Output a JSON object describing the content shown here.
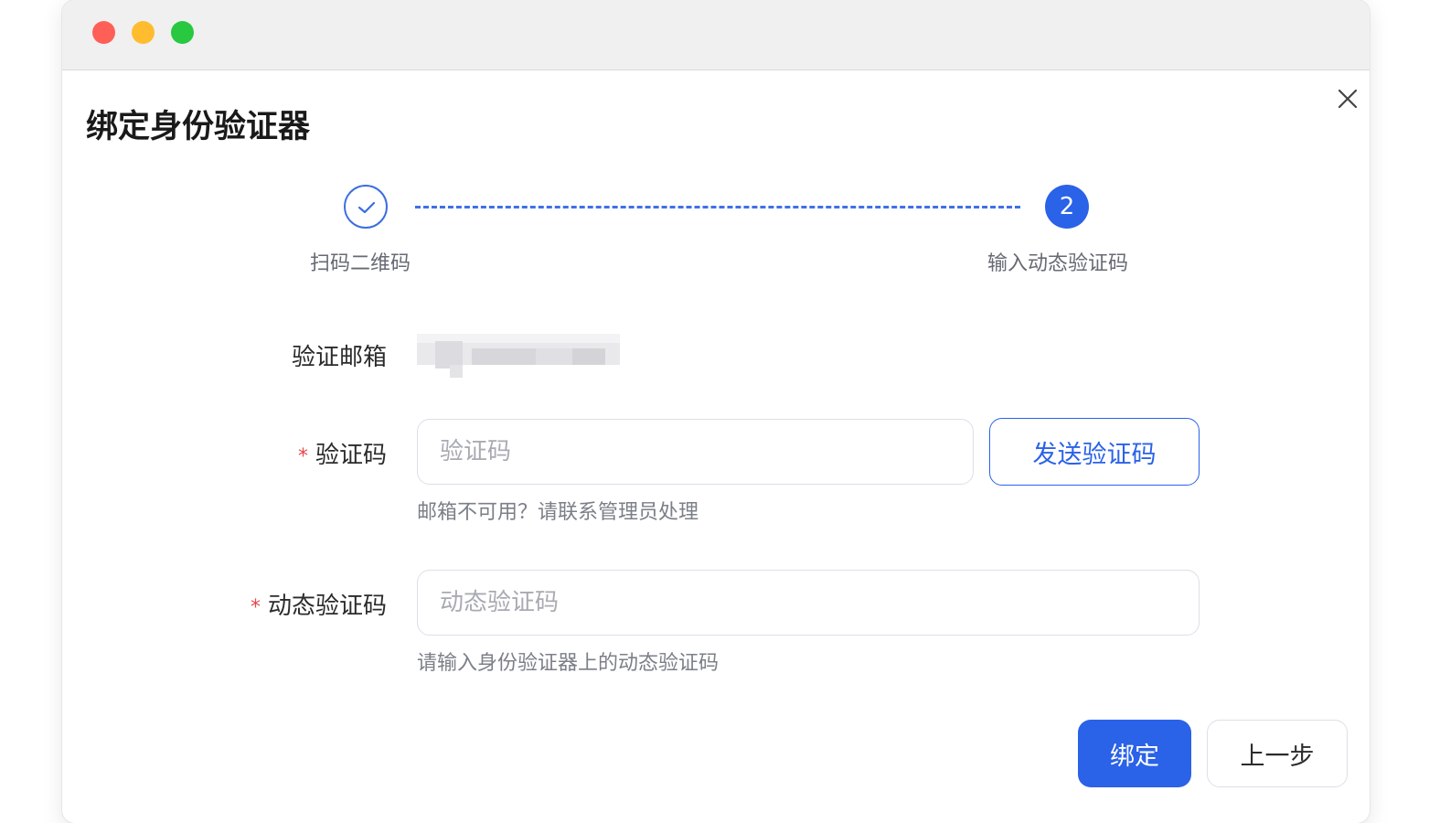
{
  "window": {
    "traffic_lights": [
      "close",
      "minimize",
      "zoom"
    ]
  },
  "dialog": {
    "title": "绑定身份验证器",
    "close_icon": "close-icon"
  },
  "steps": [
    {
      "label": "扫码二维码",
      "status": "done",
      "icon": "check-icon"
    },
    {
      "label": "输入动态验证码",
      "status": "active",
      "number": "2"
    }
  ],
  "form": {
    "email": {
      "label": "验证邮箱",
      "value_redacted": true
    },
    "code": {
      "label": "验证码",
      "required_mark": "*",
      "placeholder": "验证码",
      "value": "",
      "send_button": "发送验证码",
      "hint": "邮箱不可用？请联系管理员处理"
    },
    "dynamic_code": {
      "label": "动态验证码",
      "required_mark": "*",
      "placeholder": "动态验证码",
      "value": "",
      "hint": "请输入身份验证器上的动态验证码"
    }
  },
  "actions": {
    "bind": "绑定",
    "back": "上一步"
  },
  "colors": {
    "primary": "#2a62e8",
    "required": "#e5484d",
    "hint": "#7b7f87"
  }
}
